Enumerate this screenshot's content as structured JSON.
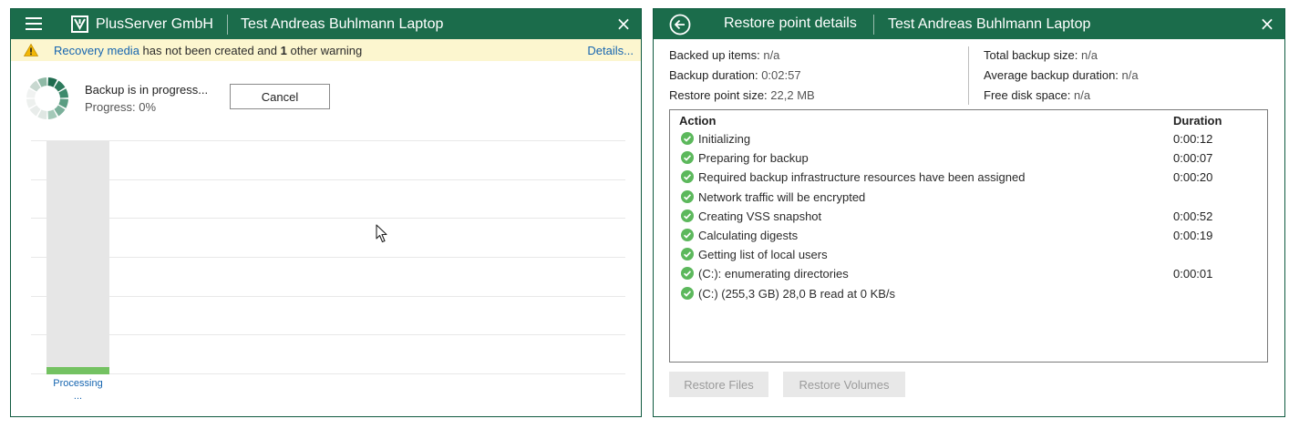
{
  "left_window": {
    "org_name": "PlusServer GmbH",
    "machine_name": "Test Andreas Buhlmann Laptop",
    "close_glyph": "×",
    "warning": {
      "link_text": "Recovery media",
      "text_middle": " has not been created and ",
      "count": "1",
      "text_end": " other warning",
      "details_label": "Details..."
    },
    "status_title": "Backup is in progress...",
    "progress_text": "Progress: 0%",
    "progress_value": 0,
    "cancel_label": "Cancel",
    "bar_label_line1": "Processing",
    "bar_label_line2": "..."
  },
  "right_window": {
    "title": "Restore point details",
    "machine_name": "Test Andreas Buhlmann Laptop",
    "close_glyph": "×",
    "info_left": [
      {
        "key": "Backed up items:",
        "value": "n/a"
      },
      {
        "key": "Backup duration:",
        "value": "0:02:57"
      },
      {
        "key": "Restore point size:",
        "value": "22,2 MB"
      }
    ],
    "info_right": [
      {
        "key": "Total backup size:",
        "value": "n/a"
      },
      {
        "key": "Average backup duration:",
        "value": "n/a"
      },
      {
        "key": "Free disk space:",
        "value": "n/a"
      }
    ],
    "table": {
      "col_action": "Action",
      "col_duration": "Duration",
      "rows": [
        {
          "action": "Initializing",
          "duration": "0:00:12"
        },
        {
          "action": "Preparing for backup",
          "duration": "0:00:07"
        },
        {
          "action": "Required backup infrastructure resources have been assigned",
          "duration": "0:00:20"
        },
        {
          "action": "Network traffic will be encrypted",
          "duration": ""
        },
        {
          "action": "Creating VSS snapshot",
          "duration": "0:00:52"
        },
        {
          "action": "Calculating digests",
          "duration": "0:00:19"
        },
        {
          "action": "Getting list of local users",
          "duration": ""
        },
        {
          "action": "(C:): enumerating directories",
          "duration": "0:00:01"
        },
        {
          "action": "(C:) (255,3 GB) 28,0 B read at 0 KB/s",
          "duration": ""
        }
      ]
    },
    "restore_files_label": "Restore Files",
    "restore_volumes_label": "Restore Volumes"
  },
  "colors": {
    "titlebar": "#1b6c4b",
    "warning_bg": "#fcf6cf",
    "link": "#1665b0",
    "success": "#5cb85c",
    "progress_fill": "#74c262"
  }
}
